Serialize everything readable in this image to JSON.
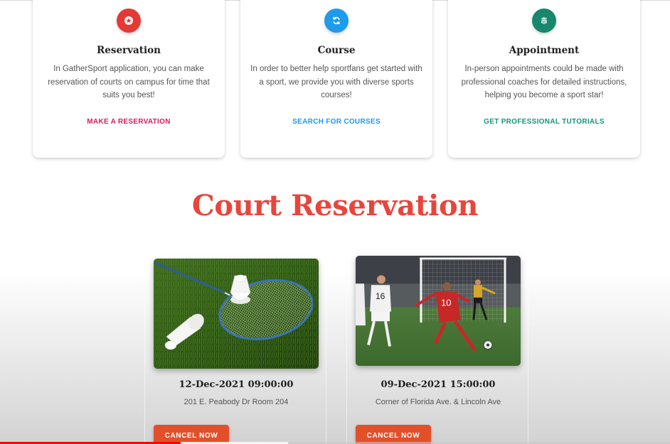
{
  "colors": {
    "accent_red": "#e8453c",
    "reservation": "#e53935",
    "course": "#1e9bea",
    "appointment": "#18876e",
    "reservation_link": "#d81b60",
    "course_link": "#2196f3",
    "appointment_link": "#16947d",
    "cancel": "#e2502a"
  },
  "features": [
    {
      "icon": "star-badge-icon",
      "title": "Reservation",
      "description": "In GatherSport application, you can make reservation of courts on campus for time that suits you best!",
      "link": "MAKE A RESERVATION"
    },
    {
      "icon": "refresh-icon",
      "title": "Course",
      "description": "In order to better help sportfans get started with a sport, we provide you with diverse sports courses!",
      "link": "SEARCH FOR COURSES"
    },
    {
      "icon": "fingerprint-icon",
      "title": "Appointment",
      "description": "In-person appointments could be made with professional coaches for detailed instructions, helping you become a sport star!",
      "link": "GET PROFESSIONAL TUTORIALS"
    }
  ],
  "section": {
    "title": "Court Reservation"
  },
  "reservations": [
    {
      "image": "badminton-racket-shuttlecock-photo",
      "datetime": "12-Dec-2021 09:00:00",
      "address": "201 E. Peabody Dr Room 204",
      "action": "CANCEL NOW"
    },
    {
      "image": "soccer-player-kicking-photo",
      "datetime": "09-Dec-2021 15:00:00",
      "address": "Corner of Florida Ave. & Lincoln Ave",
      "action": "CANCEL NOW"
    }
  ],
  "video_progress": 0.27
}
